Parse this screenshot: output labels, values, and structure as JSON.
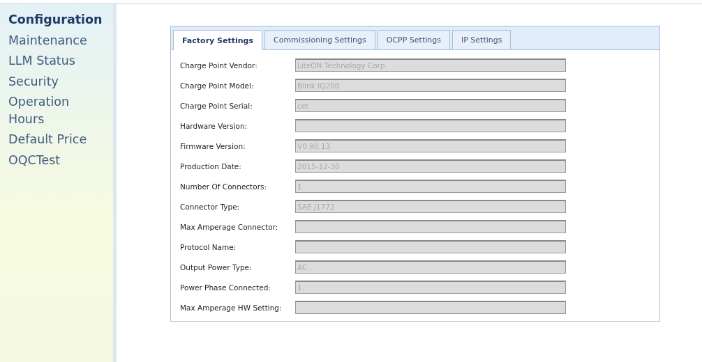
{
  "sidebar": {
    "items": [
      {
        "label": "Configuration",
        "selected": true
      },
      {
        "label": "Maintenance",
        "selected": false
      },
      {
        "label": "LLM Status",
        "selected": false
      },
      {
        "label": "Security",
        "selected": false
      },
      {
        "label": "Operation Hours",
        "selected": false
      },
      {
        "label": "Default Price",
        "selected": false
      },
      {
        "label": "OQCTest",
        "selected": false
      }
    ]
  },
  "tabs": [
    {
      "label": "Factory Settings",
      "selected": true
    },
    {
      "label": "Commissioning Settings",
      "selected": false
    },
    {
      "label": "OCPP Settings",
      "selected": false
    },
    {
      "label": "IP Settings",
      "selected": false
    }
  ],
  "fields": [
    {
      "label": "Charge Point Vendor:",
      "value": "LiteON Technology Corp.",
      "disabled": true
    },
    {
      "label": "Charge Point Model:",
      "value": "Blink IQ200",
      "disabled": true
    },
    {
      "label": "Charge Point Serial:",
      "value": "cet",
      "disabled": true
    },
    {
      "label": "Hardware Version:",
      "disabled": true
    },
    {
      "label": "Firmware Version:",
      "value": "V0.90.13",
      "disabled": true
    },
    {
      "label": "Production Date:",
      "value": "2015-12-30",
      "disabled": true
    },
    {
      "label": "Number Of Connectors:",
      "value": "1",
      "disabled": true
    },
    {
      "label": "Connector Type:",
      "value": "SAE J1772",
      "disabled": true
    },
    {
      "label": "Max Amperage Connector:",
      "disabled": true
    },
    {
      "label": "Protocol Name:",
      "disabled": true
    },
    {
      "label": "Output Power Type:",
      "value": "AC",
      "disabled": true
    },
    {
      "label": "Power Phase Connected:",
      "value": "1",
      "disabled": true
    },
    {
      "label": "Max Amperage HW Setting:",
      "disabled": true
    }
  ]
}
